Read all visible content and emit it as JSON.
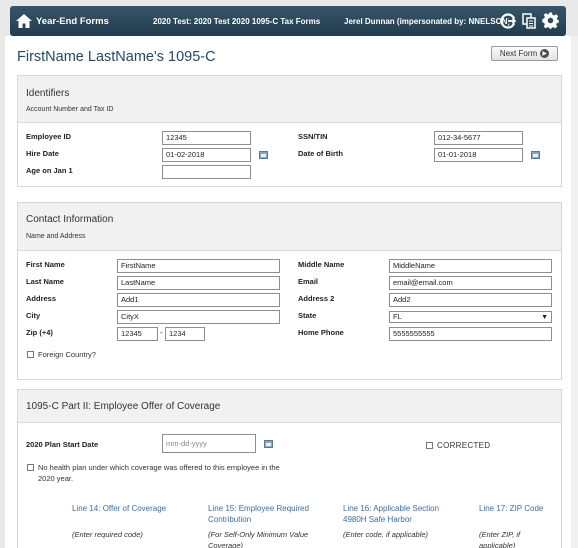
{
  "topbar": {
    "home_label": "Year-End Forms",
    "context": "2020 Test: 2020 Test 2020 1095-C Tax Forms",
    "user": "Jerel Dunnan (impersonated by: NNELSON)"
  },
  "page": {
    "title": "FirstName LastName's 1095-C",
    "next_label": "Next Form"
  },
  "identifiers": {
    "title": "Identifiers",
    "subtitle": "Account Number and Tax ID",
    "employee_id_label": "Employee ID",
    "employee_id": "12345",
    "ssn_label": "SSN/TIN",
    "ssn": "012-34-5677",
    "hire_date_label": "Hire Date",
    "hire_date": "01-02-2018",
    "dob_label": "Date of Birth",
    "dob": "01-01-2018",
    "age_label": "Age on Jan 1",
    "age": ""
  },
  "contact": {
    "title": "Contact Information",
    "subtitle": "Name and Address",
    "first_name_label": "First Name",
    "first_name": "FirstName",
    "middle_name_label": "Middle Name",
    "middle_name": "MiddleName",
    "last_name_label": "Last Name",
    "last_name": "LastName",
    "email_label": "Email",
    "email": "email@email.com",
    "address_label": "Address",
    "address": "Add1",
    "address2_label": "Address 2",
    "address2": "Add2",
    "city_label": "City",
    "city": "CityX",
    "state_label": "State",
    "state": "FL",
    "zip_label": "Zip (+4)",
    "zip": "12345",
    "zip4": "1234",
    "zip_sep": "-",
    "phone_label": "Home Phone",
    "phone": "5555555555",
    "foreign_label": "Foreign Country?"
  },
  "part2": {
    "title": "1095-C Part II: Employee Offer of Coverage",
    "plan_start_label": "2020 Plan Start Date",
    "plan_start_placeholder": "mm-dd-yyyy",
    "corrected_label": "CORRECTED",
    "no_plan_line1": "No health plan under which coverage was offered to this employee in the",
    "no_plan_line2": "2020 year.",
    "columns": [
      {
        "head1": "Line 14: Offer of Coverage",
        "head2": "",
        "hint1": "(Enter required code)",
        "hint2": ""
      },
      {
        "head1": "Line 15: Employee Required",
        "head2": "Contribution",
        "hint1": "(For Self-Only Minimum Value",
        "hint2": "Coverage)"
      },
      {
        "head1": "Line 16: Applicable Section",
        "head2": "4980H Safe Harbor",
        "hint1": "(Enter code, if applicable)",
        "hint2": ""
      },
      {
        "head1": "Line 17: ZIP Code",
        "head2": "",
        "hint1": "(Enter ZIP, if",
        "hint2": "applicable)"
      }
    ]
  },
  "colors": {
    "topbar": "#223c4d",
    "title": "#244a66",
    "link_blue": "#3a6fb0"
  }
}
